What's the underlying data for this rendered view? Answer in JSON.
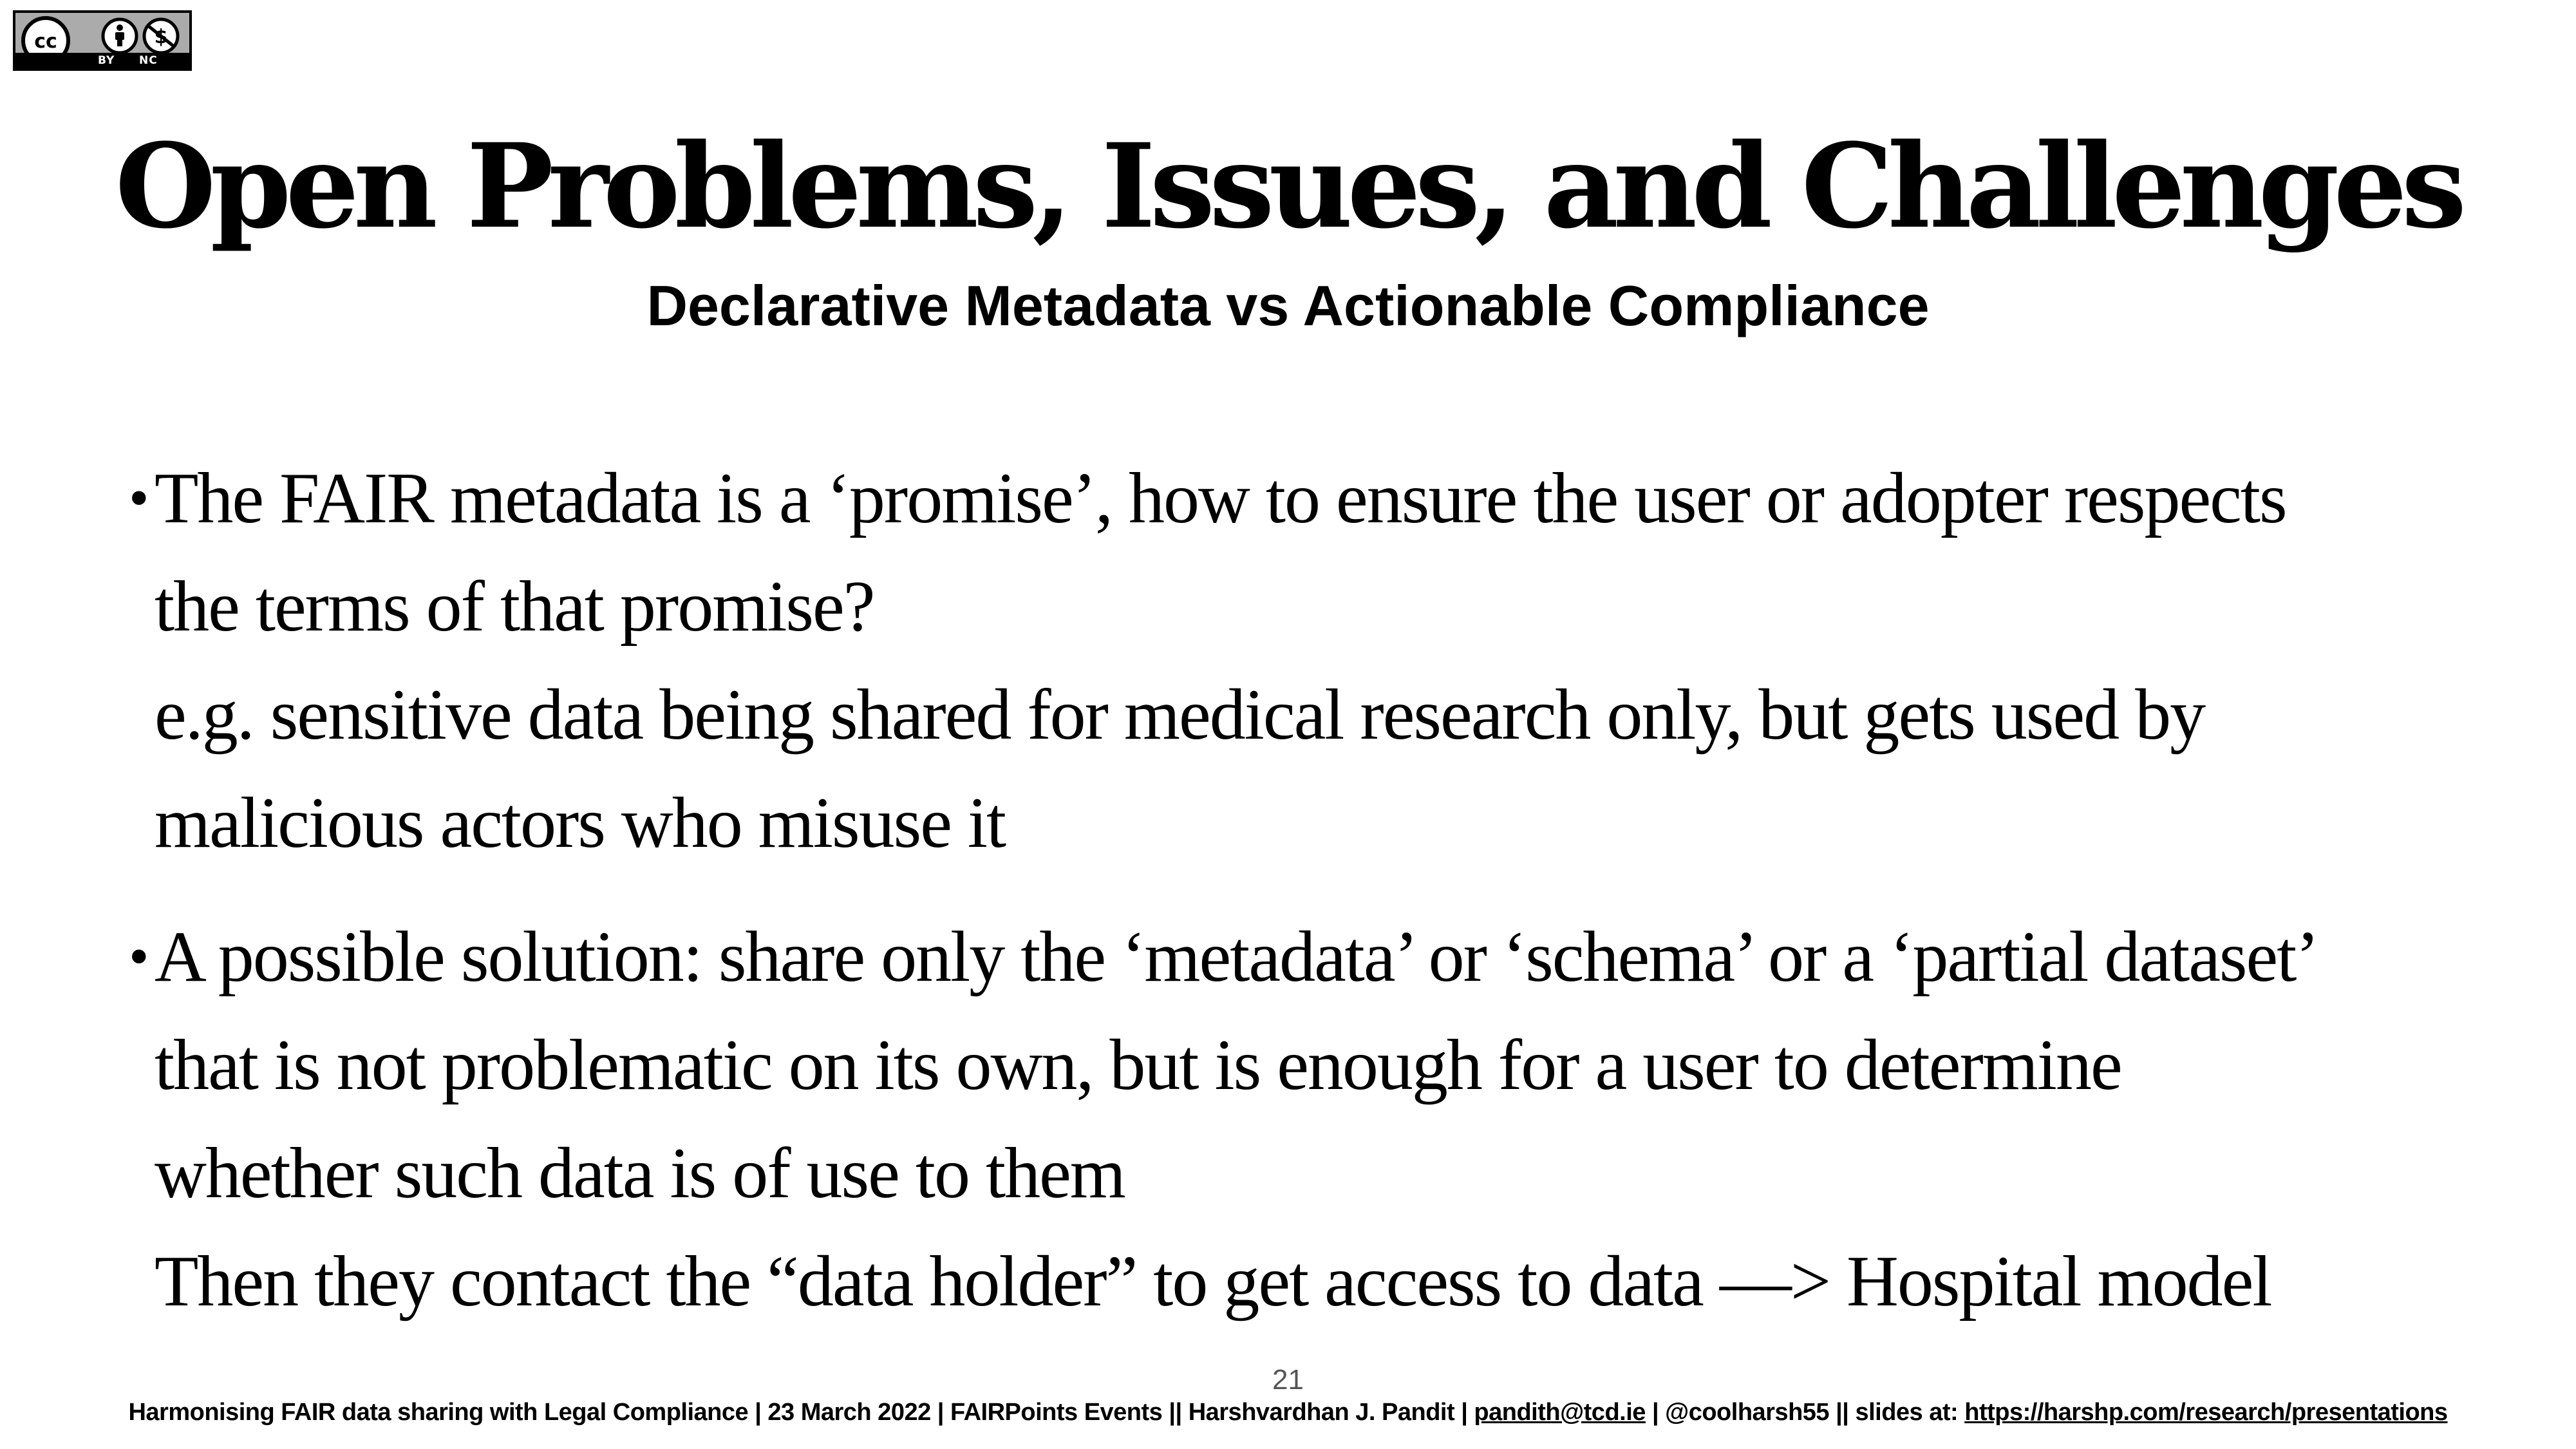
{
  "license_badge": {
    "icons": [
      "cc-icon",
      "attribution-icon",
      "noncommercial-icon"
    ],
    "cc_text": "cc",
    "by_label": "BY",
    "nc_label": "NC"
  },
  "slide": {
    "title": "Open Problems, Issues, and Challenges",
    "subtitle": "Declarative Metadata vs Actionable Compliance",
    "bullets": [
      {
        "lines": [
          "The FAIR metadata is a ‘promise’, how to ensure the user or adopter respects",
          "the terms of that promise?",
          "e.g. sensitive data being shared for medical research only, but gets used by",
          "malicious actors who misuse it"
        ]
      },
      {
        "lines": [
          "A possible solution: share only the ‘metadata’ or ‘schema’ or a ‘partial dataset’",
          "that is not problematic on its own, but is enough for a user to determine",
          "whether such data is of use to them",
          "Then they contact the “data holder” to get access to data —> Hospital model"
        ]
      }
    ],
    "page_number": "21"
  },
  "footer": {
    "text_before_email": "Harmonising FAIR data sharing with Legal Compliance | 23 March 2022 | FAIRPoints Events  || Harshvardhan J. Pandit | ",
    "email": "pandith@tcd.ie",
    "text_middle": " | @coolharsh55  || slides at: ",
    "slides_url": "https://harshp.com/research/presentations"
  },
  "colors": {
    "background": "#ffffff",
    "text": "#000000",
    "badge_gray": "#ababab"
  }
}
